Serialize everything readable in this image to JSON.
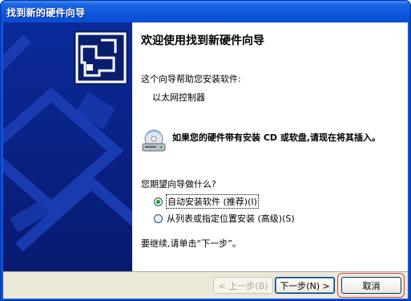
{
  "window": {
    "title": "找到新的硬件向导"
  },
  "panel": {
    "heading": "欢迎使用找到新硬件向导",
    "intro": "这个向导帮助您安装软件:",
    "device": "以太网控制器",
    "cd_note": "如果您的硬件带有安装 CD 或软盘,请现在将其插入。",
    "question": "您期望向导做什么?",
    "options": [
      {
        "label": "自动安装软件 (推荐)(I)",
        "selected": true
      },
      {
        "label": "从列表或指定位置安装 (高级)(S)",
        "selected": false
      }
    ],
    "continue_text": "要继续,请单击“下一步”。"
  },
  "buttons": {
    "back": "< 上一步(B)",
    "next": "下一步(N) >",
    "cancel": "取消"
  },
  "colors": {
    "titlebar": "#0a53e0",
    "sidebar": "#0a2388",
    "dialog": "#ece9d8",
    "cancel_highlight": "#d64545"
  },
  "icons": {
    "wizard": "hardware-wizard-icon",
    "cd": "cd-drive-icon"
  }
}
